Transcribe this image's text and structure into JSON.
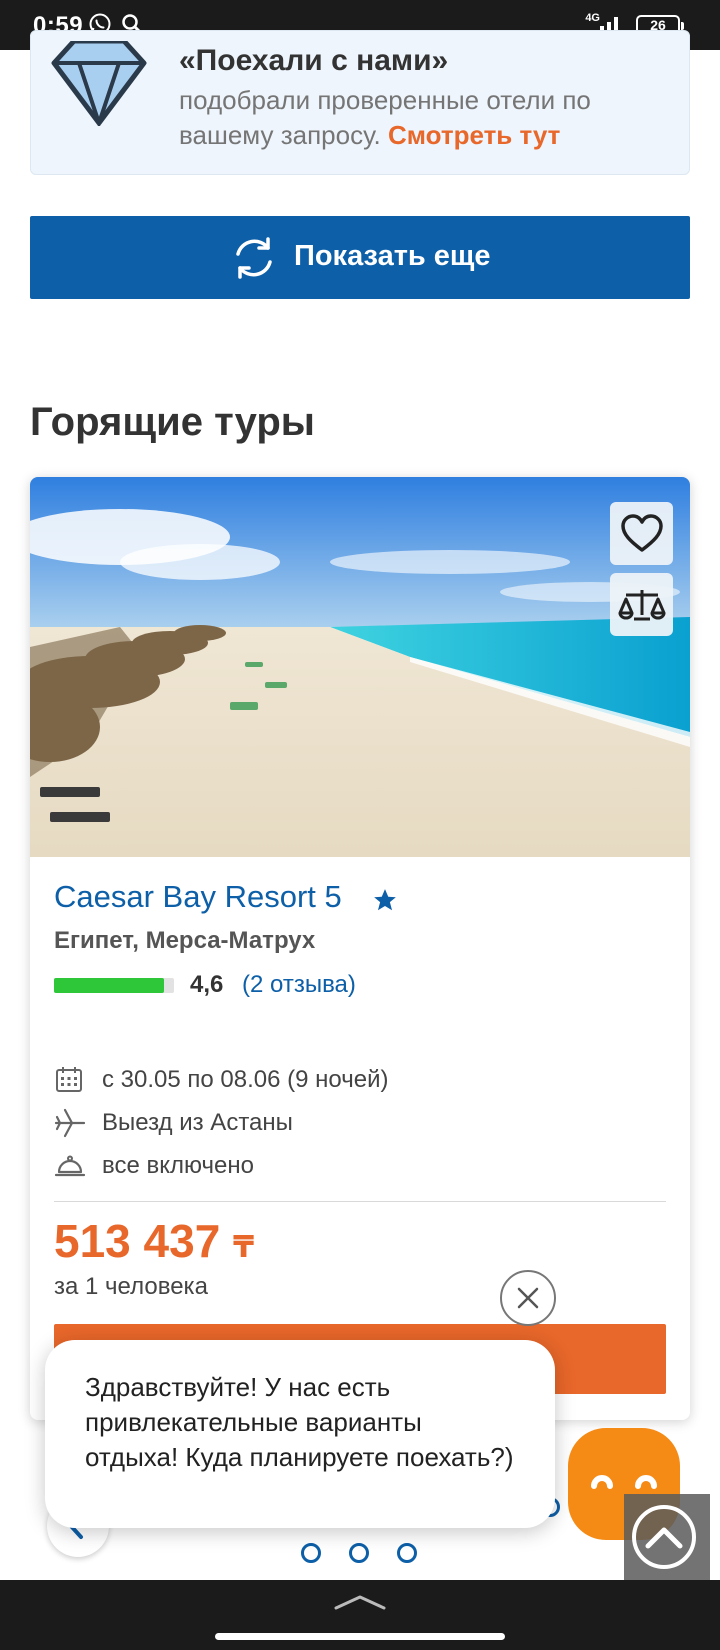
{
  "status_bar": {
    "time": "0:59",
    "network": "4G",
    "battery": "26"
  },
  "promo": {
    "title": "«Поехали с нами»",
    "text": "подобрали проверенные отели по вашему запросу.",
    "link": "Смотреть тут"
  },
  "show_more": {
    "label": "Показать еще"
  },
  "hot_tours": {
    "title": "Горящие туры",
    "card": {
      "hotel_name": "Caesar Bay Resort 5",
      "location": "Египет, Мерса-Матрух",
      "rating": "4,6",
      "rating_fraction": 0.92,
      "reviews": "(2 отзыва)",
      "dates": "с 30.05 по 08.06 (9 ночей)",
      "departure": "Выезд из Астаны",
      "meal": "все включено",
      "price": "513 437",
      "currency": "₸",
      "price_note": "за 1 человека"
    }
  },
  "chat": {
    "message": "Здравствуйте! У нас есть привлекательные варианты отдыха! Куда планируете поехать?)"
  },
  "colors": {
    "brand_blue": "#0d5fa8",
    "accent_orange": "#e8672a",
    "rating_green": "#2ec73a",
    "chat_orange": "#f58a14"
  }
}
